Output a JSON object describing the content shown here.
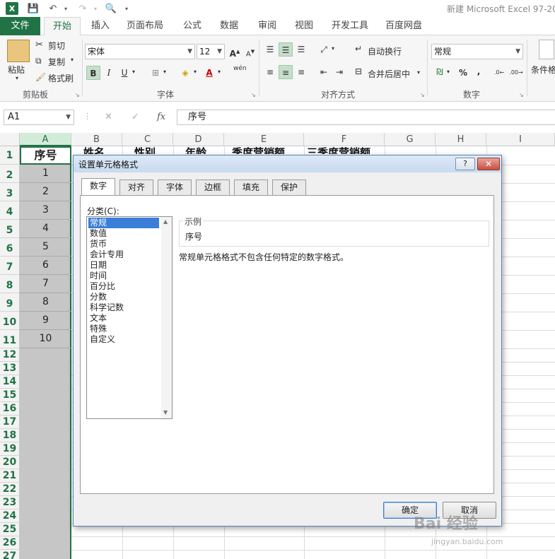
{
  "window": {
    "title": "新建 Microsoft Excel 97-20"
  },
  "tabs": [
    "文件",
    "开始",
    "插入",
    "页面布局",
    "公式",
    "数据",
    "审阅",
    "视图",
    "开发工具",
    "百度网盘"
  ],
  "ribbon": {
    "paste": "粘贴",
    "cut": "剪切",
    "copy": "复制",
    "format_painter": "格式刷",
    "clipboard_label": "剪贴板",
    "font_name": "宋体",
    "font_size": "12",
    "font_label": "字体",
    "wrap_text": "自动换行",
    "merge_center": "合并后居中",
    "align_label": "对齐方式",
    "number_format": "常规",
    "number_label": "数字",
    "cond_format": "条件格",
    "bold": "B",
    "italic": "I",
    "underline": "U",
    "percent": "%",
    "comma": ",",
    "wen": "wén"
  },
  "formula_bar": {
    "name_box": "A1",
    "content": "序号"
  },
  "grid": {
    "columns": [
      "A",
      "B",
      "C",
      "D",
      "E",
      "F",
      "G",
      "H",
      "I"
    ],
    "rows": [
      "1",
      "2",
      "3",
      "4",
      "5",
      "6",
      "7",
      "8",
      "9",
      "10",
      "11",
      "12",
      "13",
      "14",
      "15",
      "16",
      "17",
      "18",
      "19",
      "20",
      "21",
      "22",
      "23",
      "24",
      "25",
      "26",
      "27"
    ],
    "a_values": [
      "序号",
      "1",
      "2",
      "3",
      "4",
      "5",
      "6",
      "7",
      "8",
      "9",
      "10"
    ],
    "header_partial": [
      "姓名",
      "性别",
      "年龄",
      "季度营销额",
      "三季度营销额"
    ]
  },
  "dialog": {
    "title": "设置单元格格式",
    "help": "?",
    "close": "✕",
    "tabs": [
      "数字",
      "对齐",
      "字体",
      "边框",
      "填充",
      "保护"
    ],
    "category_label": "分类(C):",
    "categories": [
      "常规",
      "数值",
      "货币",
      "会计专用",
      "日期",
      "时间",
      "百分比",
      "分数",
      "科学记数",
      "文本",
      "特殊",
      "自定义"
    ],
    "sample_legend": "示例",
    "sample_value": "序号",
    "description": "常规单元格格式不包含任何特定的数字格式。",
    "ok": "确定",
    "cancel": "取消"
  },
  "watermark": {
    "brand": "Bai 经验",
    "url": "jingyan.baidu.com"
  }
}
